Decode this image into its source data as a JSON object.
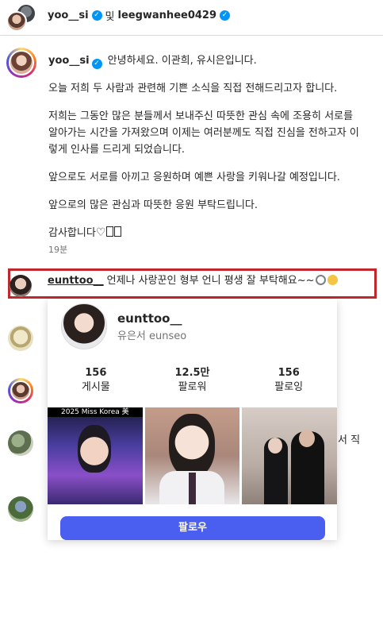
{
  "header": {
    "user1": "yoo__si",
    "conjunction": "및",
    "user2": "leegwanhee0429"
  },
  "post": {
    "username": "yoo__si",
    "greeting": "안녕하세요. 이관희, 유시은입니다.",
    "paragraphs": [
      "오늘 저희 두 사람과 관련해 기쁜 소식을 직접 전해드리고자 합니다.",
      "저희는 그동안 많은 분들께서 보내주신 따뜻한 관심 속에 조용히 서로를 알아가는 시간을 가져왔으며 이제는 여러분께도 직접 진심을 전하고자 이렇게 인사를 드리게 되었습니다.",
      "앞으로도 서로를 아끼고 응원하며 예쁜 사랑을 키워나갈 예정입니다.",
      "앞으로의 많은 관심과 따뜻한 응원 부탁드립니다."
    ],
    "closing": "감사합니다",
    "time": "19분"
  },
  "comment": {
    "username": "eunttoo__",
    "text": "언제나 사랑꾼인 형부 언니 평생 잘 부탁해요~~"
  },
  "side_peek_text": "서 직",
  "hover_card": {
    "username": "eunttoo__",
    "display_name": "유은서 eunseo",
    "stats": [
      {
        "value": "156",
        "label": "게시물"
      },
      {
        "value": "12.5만",
        "label": "팔로워"
      },
      {
        "value": "156",
        "label": "팔로잉"
      }
    ],
    "thumb_caption": "2025 Miss Korea 美",
    "follow_label": "팔로우"
  },
  "colors": {
    "accent": "#4a5ef0",
    "verified": "#0095f6",
    "highlight_border": "#c0282d"
  }
}
